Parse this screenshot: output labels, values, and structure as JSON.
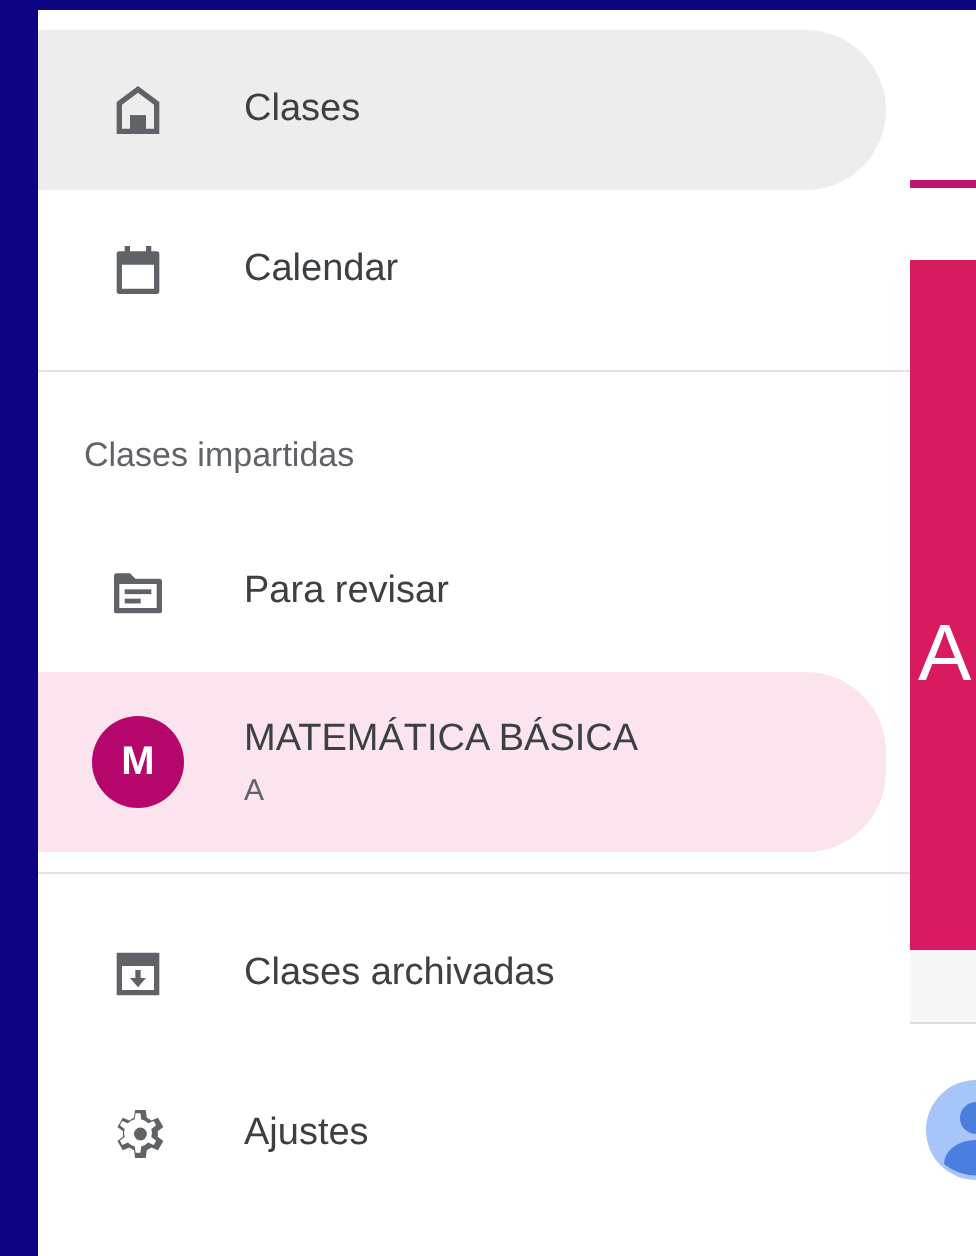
{
  "drawer": {
    "sections": [
      {
        "items": [
          {
            "kind": "icon",
            "label": "Clases",
            "selected": true
          },
          {
            "kind": "icon",
            "label": "Calendar",
            "selected": false
          }
        ]
      },
      {
        "header": "Clases impartidas",
        "items": [
          {
            "kind": "icon",
            "label": "Para revisar",
            "selected": false
          },
          {
            "kind": "avatar",
            "initial": "M",
            "label": "MATEMÁTICA BÁSICA",
            "subtitle": "A",
            "color": "#b5076b",
            "selected": true
          }
        ]
      },
      {
        "items": [
          {
            "kind": "icon",
            "label": "Clases archivadas",
            "selected": false
          },
          {
            "kind": "icon",
            "label": "Ajustes",
            "selected": false
          }
        ]
      }
    ]
  },
  "background": {
    "class_card": {
      "letter": "A"
    }
  }
}
